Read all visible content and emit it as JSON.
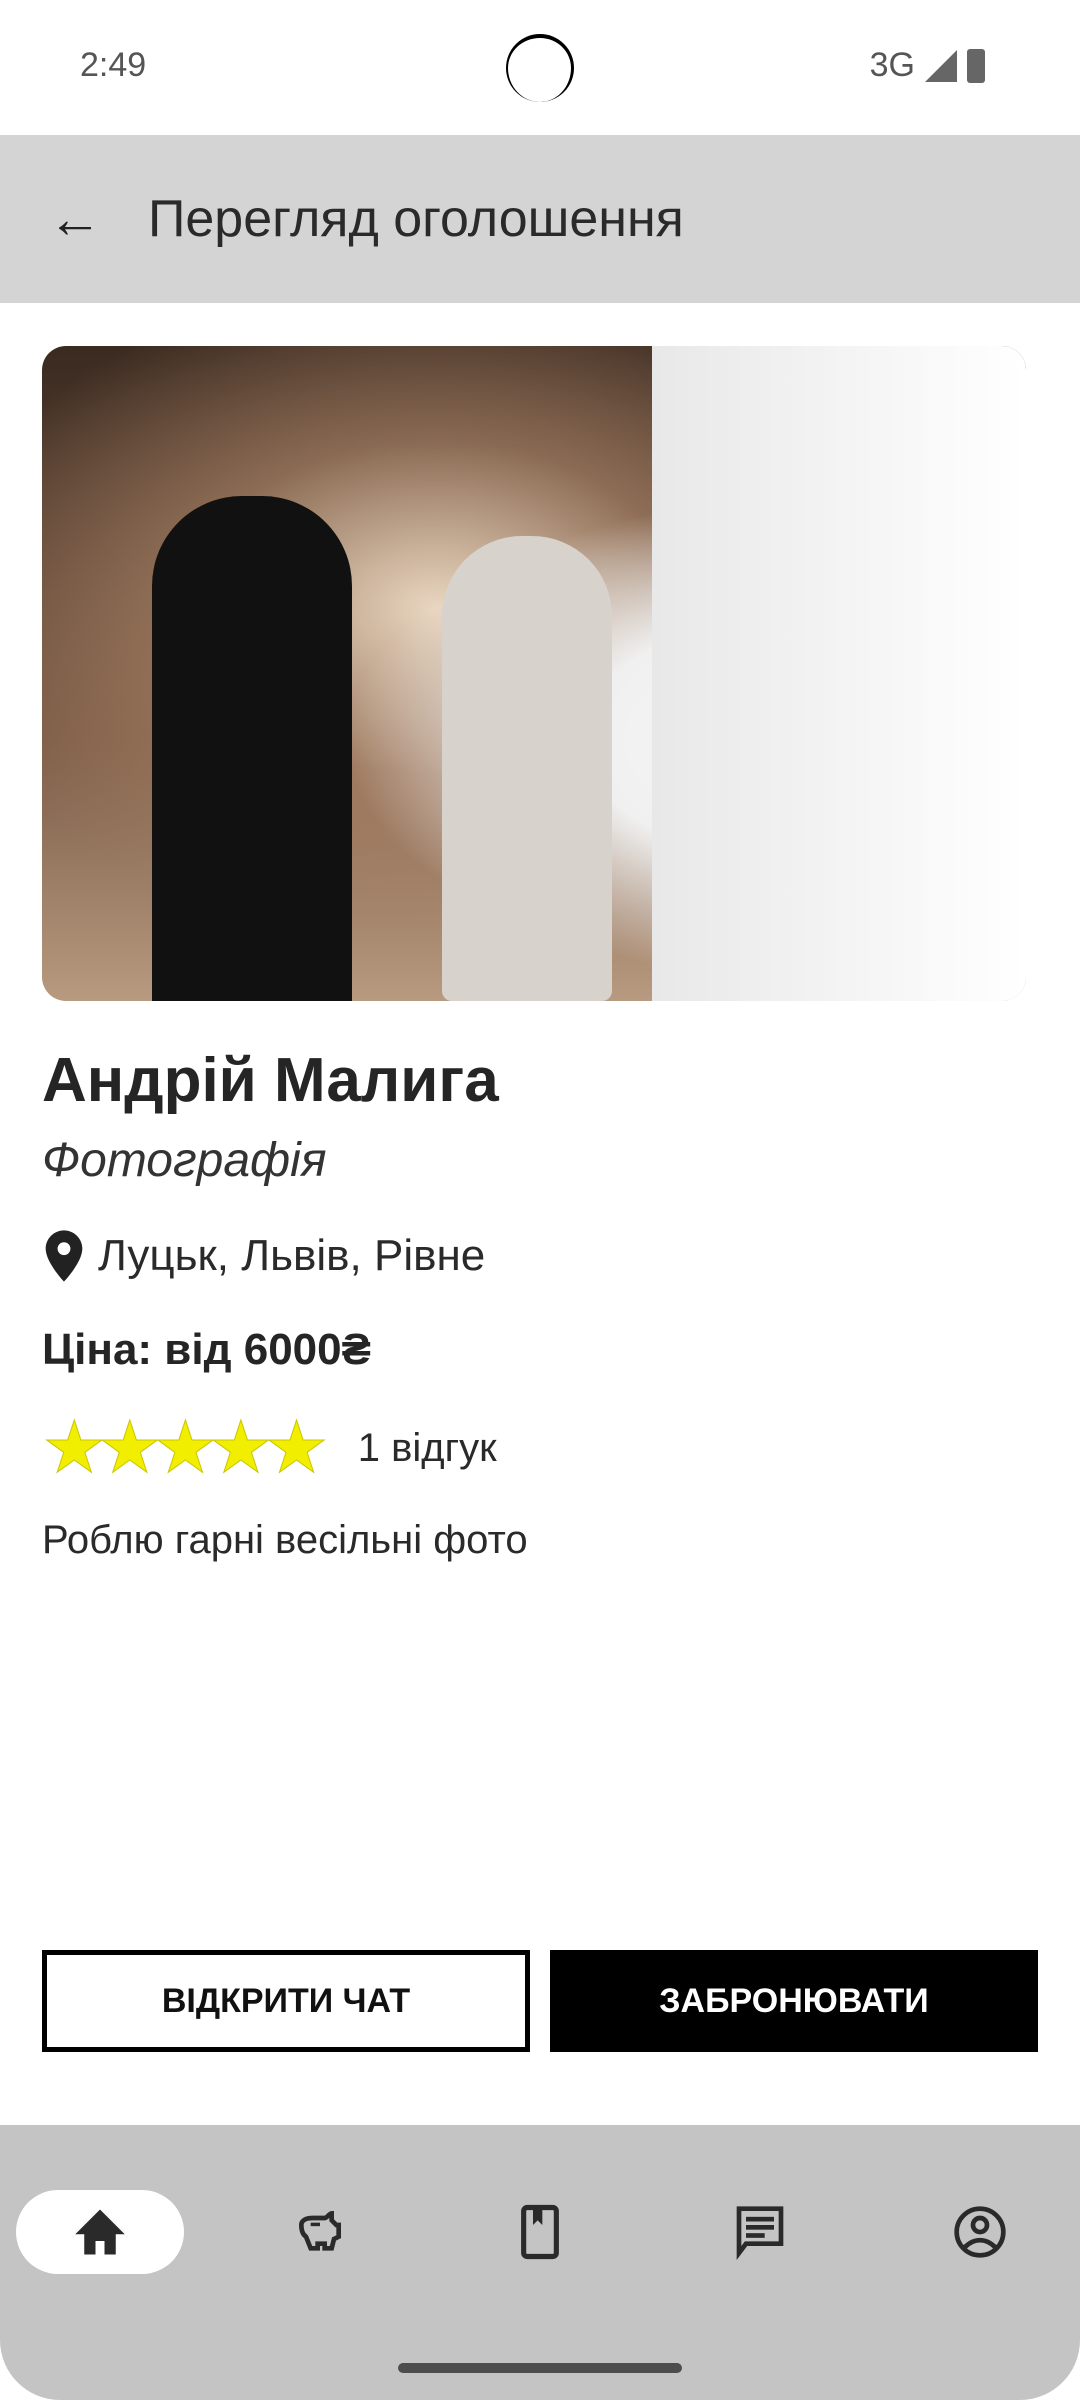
{
  "status_bar": {
    "time": "2:49",
    "network": "3G"
  },
  "app_bar": {
    "title": "Перегляд оголошення",
    "back_icon": "arrow-back-icon"
  },
  "listing": {
    "name": "Андрій Малига",
    "category": "Фотографія",
    "location": "Луцьк, Львів, Рівне",
    "price": "Ціна: від 6000₴",
    "rating": 5,
    "rating_max": 5,
    "reviews": "1 відгук",
    "description": "Роблю гарні весільні фото"
  },
  "actions": {
    "chat": "ВІДКРИТИ ЧАТ",
    "book": "ЗАБРОНЮВАТИ"
  },
  "nav": {
    "items": [
      "home-icon",
      "piggy-bank-icon",
      "bookmark-book-icon",
      "chat-icon",
      "account-icon"
    ],
    "selected": 0
  },
  "colors": {
    "star": "#f2ee00",
    "appbar": "#d4d4d4",
    "nav": "#c4c4c4"
  }
}
